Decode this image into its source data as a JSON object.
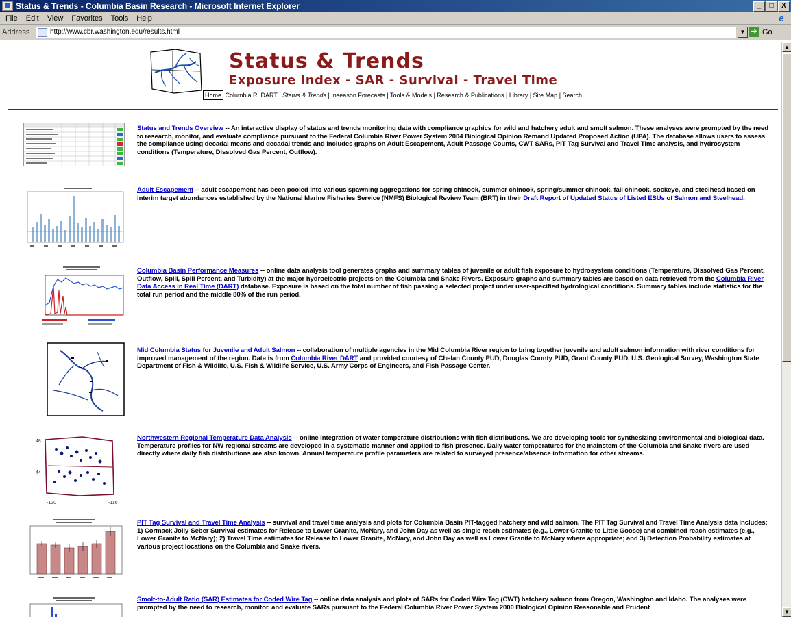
{
  "window": {
    "title": "Status & Trends - Columbia Basin Research - Microsoft Internet Explorer",
    "minimize": "_",
    "maximize": "□",
    "close": "X"
  },
  "menubar": {
    "items": [
      "File",
      "Edit",
      "View",
      "Favorites",
      "Tools",
      "Help"
    ]
  },
  "addressbar": {
    "label": "Address",
    "url": "http://www.cbr.washington.edu/results.html",
    "go_label": "Go"
  },
  "header": {
    "title": "Status & Trends",
    "subtitle": "Exposure Index - SAR - Survival - Travel Time",
    "nav": {
      "home": "Home",
      "columbia": "Columbia R. DART",
      "status": "Status & Trends",
      "inseason": "Inseason Forecasts",
      "tools": "Tools & Models",
      "research": "Research & Publications",
      "library": "Library",
      "sitemap": "Site Map",
      "search": "Search",
      "sep": " | "
    }
  },
  "entries": [
    {
      "link": "Status and Trends Overview",
      "text": " -- An interactive display of status and trends monitoring data with compliance graphics for wild and hatchery adult and smolt salmon. These analyses were prompted by the need to research, monitor, and evaluate compliance pursuant to the Federal Columbia River Power System 2004 Biological Opinion Remand Updated Proposed Action (UPA). The database allows users to assess the compliance using decadal means and decadal trends and includes graphs on Adult Escapement, Adult Passage Counts, CWT SARs, PIT Tag Survival and Travel Time analysis, and hydrosystem conditions (Temperature, Dissolved Gas Percent, Outflow)."
    },
    {
      "link": "Adult Escapement",
      "text": " -- adult escapement has been pooled into various spawning aggregations for spring chinook, summer chinook, spring/summer chinook, fall chinook, sockeye, and steelhead based on interim target abundances established by the National Marine Fisheries Service (NMFS) Biological Review Team (BRT) in their ",
      "link2": "Draft Report of Updated Status of Listed ESUs of Salmon and Steelhead",
      "text2": "."
    },
    {
      "link": "Columbia Basin Performance Measures",
      "text": " -- online data analysis tool generates graphs and summary tables of juvenile or adult fish exposure to hydrosystem conditions (Temperature, Dissolved Gas Percent, Outflow, Spill, Spill Percent, and Turbidity) at the major hydroelectric projects on the Columbia and Snake Rivers. Exposure graphs and summary tables are based on data retrieved from the ",
      "link2": "Columbia River Data Access in Real Time (DART)",
      "text2": " database. Exposure is based on the total number of fish passing a selected project under user-specified hydrological conditions. Summary tables include statistics for the total run period and the middle 80% of the run period."
    },
    {
      "link": "Mid Columbia Status for Juvenile and Adult Salmon",
      "text": " -- collaboration of multiple agencies in the Mid Columbia River region to bring together juvenile and adult salmon information with river conditions for improved management of the region. Data is from ",
      "link2": "Columbia River DART",
      "text2": " and provided courtesy of Chelan County PUD, Douglas County PUD, Grant County PUD, U.S. Geological Survey, Washington State Department of Fish & Wildlife, U.S. Fish & Wildlife Service, U.S. Army Corps of Engineers, and Fish Passage Center."
    },
    {
      "link": "Northwestern Regional Temperature Data Analysis",
      "text": " -- online integration of water temperature distributions with fish distributions. We are developing tools for synthesizing environmental and biological data. Temperature profiles for NW regional streams are developed in a systematic manner and applied to fish presence. Daily water temperatures for the mainstem of the Columbia and Snake rivers are used directly where daily fish distributions are also known. Annual temperature profile parameters are related to surveyed presence/absence information for other streams."
    },
    {
      "link": "PIT Tag Survival and Travel Time Analysis",
      "text": " -- survival and travel time analysis and plots for Columbia Basin PIT-tagged hatchery and wild salmon. The PIT Tag Survival and Travel Time Analysis data includes: 1) Cormack Jolly-Seber Survival estimates for Release to Lower Granite, McNary, and John Day as well as single reach estimates (e.g., Lower Granite to Little Goose) and combined reach estimates (e.g., Lower Granite to McNary); 2) Travel Time estimates for Release to Lower Granite, McNary, and John Day as well as Lower Granite to McNary where appropriate; and 3) Detection Probability estimates at various project locations on the Columbia and Snake rivers."
    },
    {
      "link": "Smolt-to-Adult Ratio (SAR) Estimates for Coded Wire Tag",
      "text": " -- online data analysis and plots of SARs for Coded Wire Tag (CWT) hatchery salmon from Oregon, Washington and Idaho. The analyses were prompted by the need to research, monitor, and evaluate SARs pursuant to the Federal Columbia River Power System 2000 Biological Opinion Reasonable and Prudent"
    }
  ],
  "thumb_labels": {
    "temp_y_top": "48",
    "temp_y_bottom": "44",
    "temp_x_left": "-120",
    "temp_x_right": "-116"
  },
  "colors": {
    "title": "#8b1a1a",
    "link": "#0000cc",
    "titlebar": "#0a246a"
  }
}
